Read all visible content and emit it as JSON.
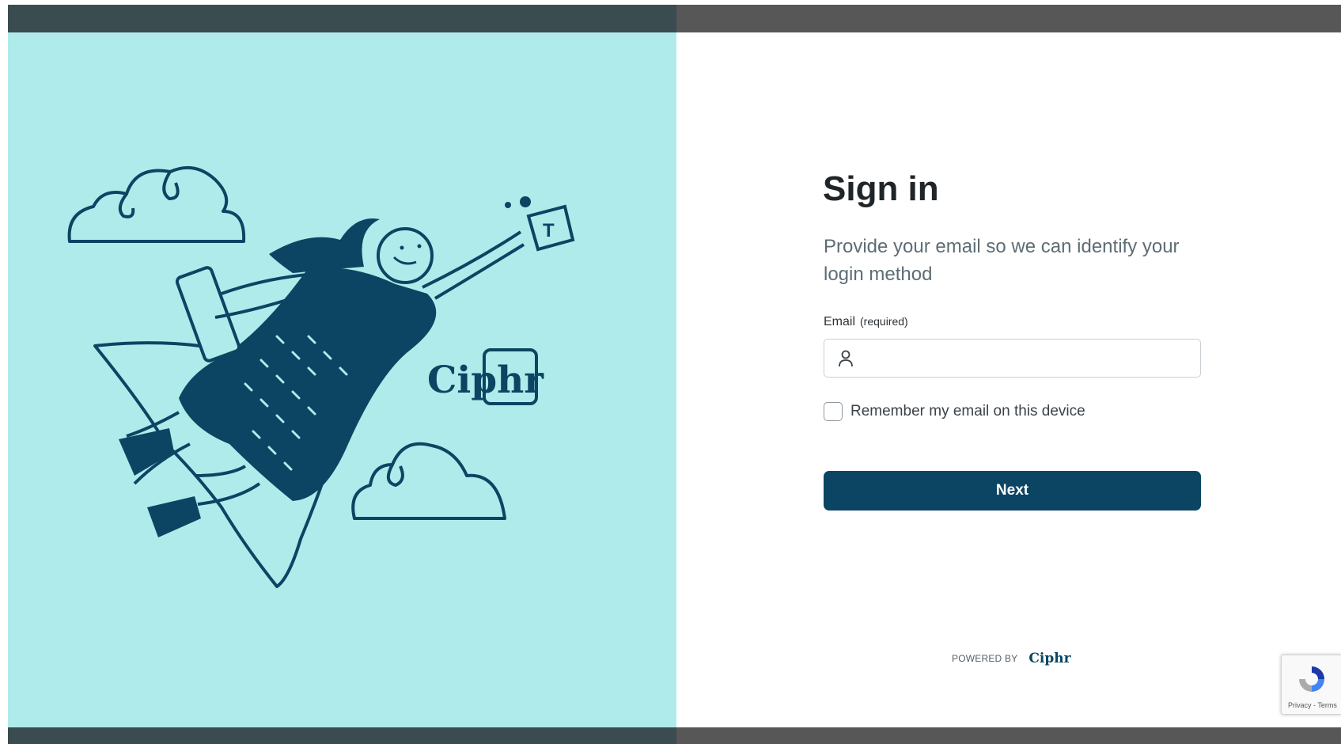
{
  "hero": {
    "brand_text": "Ciphr",
    "mug_letter": "T"
  },
  "form": {
    "title": "Sign in",
    "subtitle": "Provide your email so we can identify your login method",
    "email_label": "Email",
    "email_required": "(required)",
    "email_value": "",
    "email_placeholder": "",
    "remember_label": "Remember my email on this device",
    "remember_checked": false,
    "next_label": "Next"
  },
  "footer": {
    "powered_by": "POWERED BY",
    "logo_text": "Ciphr"
  },
  "recaptcha": {
    "links": "Privacy - Terms"
  },
  "colors": {
    "hero_bg": "#b0ebeb",
    "ink": "#0b4563",
    "button": "#0b4563"
  }
}
